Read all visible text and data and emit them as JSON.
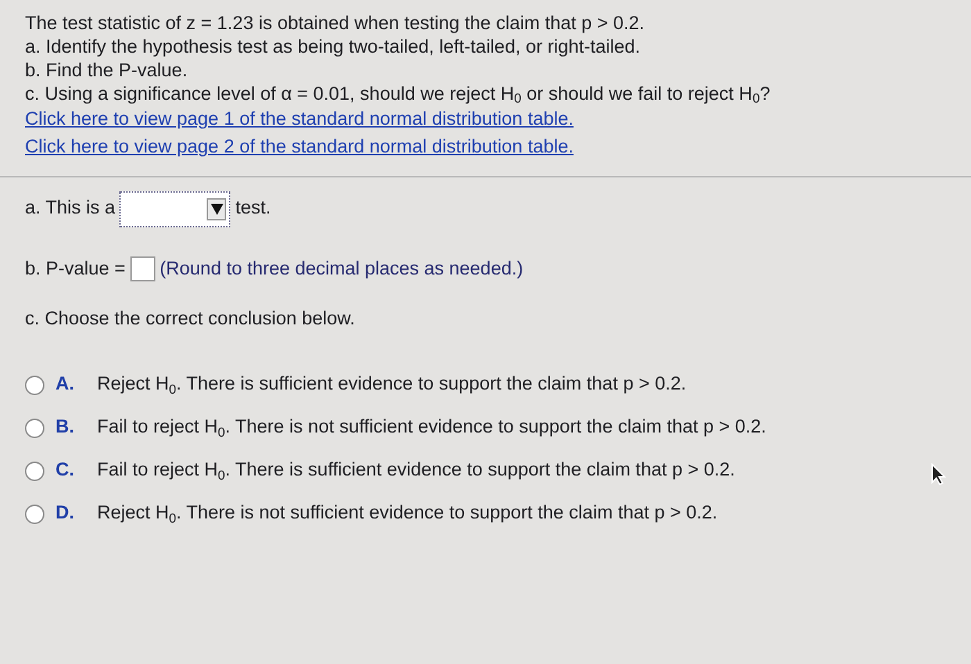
{
  "question": {
    "lines": [
      "The test statistic of z = 1.23 is obtained when testing the claim that p > 0.2.",
      "a. Identify the hypothesis test as being two-tailed, left-tailed, or right-tailed.",
      "b. Find the P-value.",
      "c. Using a significance level of α = 0.01, should we reject H$_{0}$ or should we fail to reject H$_{0}$?"
    ],
    "links": [
      "Click here to view page 1 of the standard normal distribution table.",
      "Click here to view page 2 of the standard normal distribution table."
    ]
  },
  "part_a": {
    "label": "a. This is a",
    "after": "test."
  },
  "part_b": {
    "label": "b. P-value =",
    "hint": "(Round to three decimal places as needed.)"
  },
  "part_c": {
    "label": "c. Choose the correct conclusion below.",
    "options": [
      {
        "letter": "A.",
        "text": "Reject H$_{0}$. There is sufficient evidence to support the claim that p > 0.2.",
        "selected": false
      },
      {
        "letter": "B.",
        "text": "Fail to reject H$_{0}$. There is not sufficient evidence to support the claim that p > 0.2.",
        "selected": false
      },
      {
        "letter": "C.",
        "text": "Fail to reject H$_{0}$. There is sufficient evidence to support the claim that p > 0.2.",
        "selected": false
      },
      {
        "letter": "D.",
        "text": "Reject H$_{0}$. There is not sufficient evidence to support the claim that p > 0.2.",
        "selected": false
      }
    ]
  }
}
